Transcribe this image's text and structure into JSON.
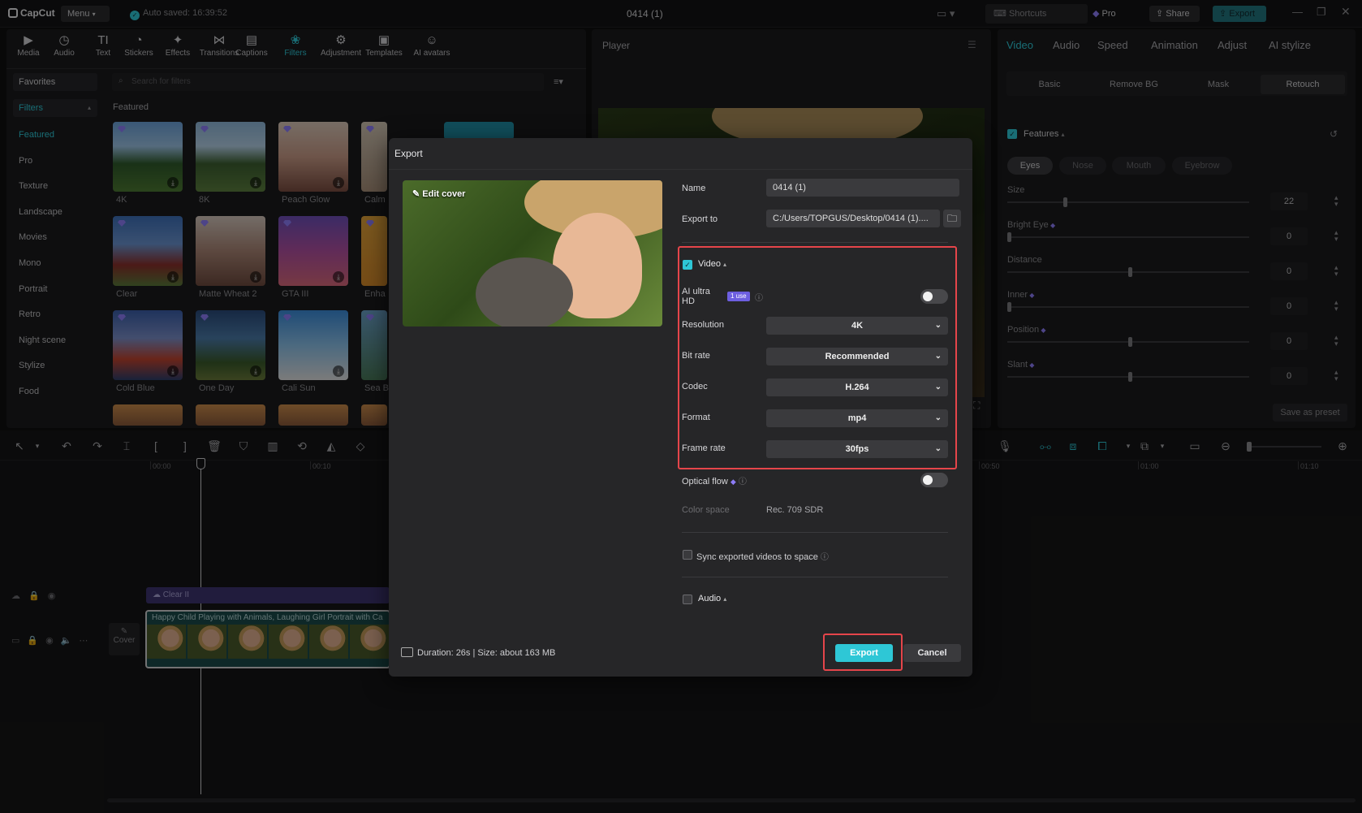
{
  "titlebar": {
    "app_name": "CapCut",
    "menu_label": "Menu",
    "autosave": "Auto saved: 16:39:52",
    "project_title": "0414 (1)",
    "shortcuts": "Shortcuts",
    "pro": "Pro",
    "share": "Share",
    "export": "Export"
  },
  "toolbar": [
    "Media",
    "Audio",
    "Text",
    "Stickers",
    "Effects",
    "Transitions",
    "Captions",
    "Filters",
    "Adjustment",
    "Templates",
    "AI avatars"
  ],
  "filters": {
    "favorites": "Favorites",
    "filters_header": "Filters",
    "categories": [
      "Featured",
      "Pro",
      "Texture",
      "Landscape",
      "Movies",
      "Mono",
      "Portrait",
      "Retro",
      "Night scene",
      "Stylize",
      "Food"
    ],
    "search_placeholder": "Search for filters",
    "section_title": "Featured",
    "items": [
      "4K",
      "8K",
      "Peach Glow",
      "Calm",
      "Clear",
      "Matte Wheat 2",
      "GTA III",
      "Enha",
      "Cold Blue",
      "One Day",
      "Cali Sun",
      "Sea B"
    ]
  },
  "player": {
    "title": "Player"
  },
  "right_panel": {
    "tabs": [
      "Video",
      "Audio",
      "Speed",
      "Animation",
      "Adjust",
      "AI stylize"
    ],
    "subtabs": [
      "Basic",
      "Remove BG",
      "Mask",
      "Retouch"
    ],
    "features_label": "Features",
    "feature_tabs": [
      "Eyes",
      "Nose",
      "Mouth",
      "Eyebrow"
    ],
    "sliders": [
      {
        "label": "Size",
        "value": "22",
        "pct": 0.23
      },
      {
        "label": "Bright Eye",
        "value": "0",
        "pct": 0
      },
      {
        "label": "Distance",
        "value": "0",
        "pct": 0.5
      },
      {
        "label": "Inner",
        "value": "0",
        "pct": 0
      },
      {
        "label": "Position",
        "value": "0",
        "pct": 0.5
      },
      {
        "label": "Slant",
        "value": "0",
        "pct": 0.5
      }
    ],
    "save_preset": "Save as preset"
  },
  "timeline": {
    "ticks": [
      "00:00",
      "00:10",
      "00:50",
      "01:00",
      "01:10"
    ],
    "filter_clip": "Clear II",
    "video_clip": "Happy Child Playing with Animals, Laughing Girl Portrait with Ca",
    "cover_label": "Cover"
  },
  "export_dialog": {
    "title": "Export",
    "edit_cover": "Edit cover",
    "name_label": "Name",
    "name_value": "0414 (1)",
    "export_to_label": "Export to",
    "export_to_value": "C:/Users/TOPGUS/Desktop/0414 (1)....",
    "video_label": "Video",
    "ai_ultra_hd_line1": "AI ultra",
    "ai_ultra_hd_line2": "HD",
    "use_badge": "1 use",
    "resolution_label": "Resolution",
    "resolution_value": "4K",
    "bitrate_label": "Bit rate",
    "bitrate_value": "Recommended",
    "codec_label": "Codec",
    "codec_value": "H.264",
    "format_label": "Format",
    "format_value": "mp4",
    "framerate_label": "Frame rate",
    "framerate_value": "30fps",
    "optical_flow_label": "Optical flow",
    "color_space_label": "Color space",
    "color_space_value": "Rec. 709 SDR",
    "sync_label": "Sync exported videos to space",
    "audio_label": "Audio",
    "duration_info": "Duration: 26s | Size: about 163 MB",
    "export_button": "Export",
    "cancel_button": "Cancel"
  },
  "colors": {
    "accent": "#2ec7d6",
    "highlight": "#e5454a",
    "pro": "#8d7cf7"
  }
}
